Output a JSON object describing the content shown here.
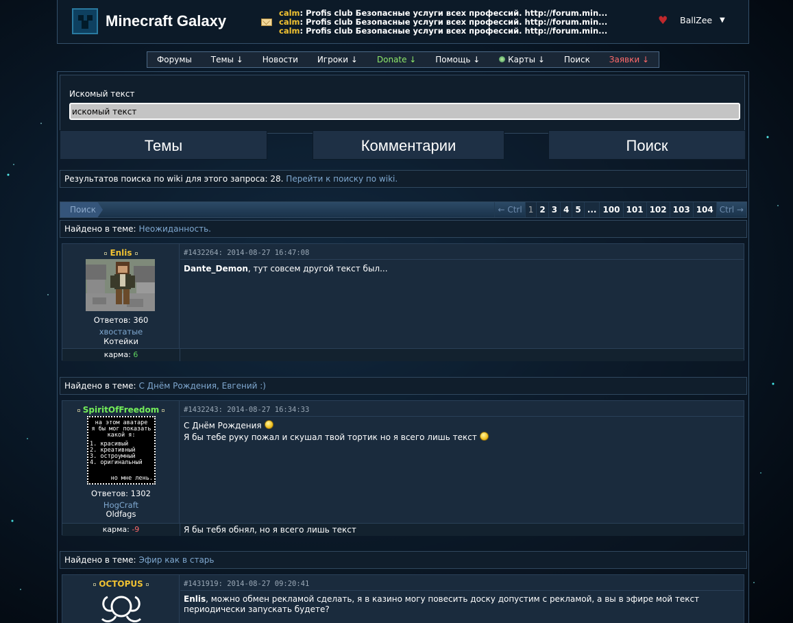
{
  "header": {
    "site_title": "Minecraft Galaxy",
    "user_name": "BallZee",
    "shouts": [
      {
        "who": "calm",
        "text": ": Profis club Безопасные услуги всех профессий. http://forum.min..."
      },
      {
        "who": "calm",
        "text": ": Profis club Безопасные услуги всех профессий. http://forum.min..."
      },
      {
        "who": "calm",
        "text": ": Profis club Безопасные услуги всех профессий. http://forum.min..."
      }
    ]
  },
  "nav": [
    "Форумы",
    "Темы ↓",
    "Новости",
    "Игроки ↓",
    "Donate ↓",
    "Помощь ↓",
    "Карты ↓",
    "Поиск",
    "Заявки ↓"
  ],
  "search": {
    "label": "Искомый текст",
    "value": "искомый текст",
    "tab_topics": "Темы",
    "tab_comments": "Комментарии",
    "tab_search": "Поиск"
  },
  "wiki": {
    "text": "Результатов поиска по wiki для этого запроса: 28.",
    "link": "Перейти к поиску по wiki."
  },
  "pager": {
    "label": "Поиск",
    "prev": "← Ctrl",
    "pages": [
      "1",
      "2",
      "3",
      "4",
      "5",
      "...",
      "100",
      "101",
      "102",
      "103",
      "104"
    ],
    "next": "Ctrl →"
  },
  "found_label": "Найдено в теме:",
  "results": [
    {
      "topic": "Неожиданность.",
      "author": "Enlis",
      "answers": "Ответов: 360",
      "clan": "хвостатые",
      "rank": "Котейки",
      "karma_label": "карма:",
      "karma": "6",
      "meta": "#1432264: 2014-08-27 16:47:08",
      "mention": "Dante_Demon",
      "line1": ", тут совсем другой текст был...",
      "line2": "",
      "signature": ""
    },
    {
      "topic": "С Днём Рождения, Евгений :)",
      "author": "SpiritOfFreedom",
      "answers": "Ответов: 1302",
      "clan": "HogCraft",
      "rank": "Oldfags",
      "karma_label": "карма:",
      "karma": "-9",
      "meta": "#1432243: 2014-08-27 16:34:33",
      "mention": "",
      "line1": "С Днём Рождения",
      "line2": "Я бы тебе руку пожал и скушал твой тортик но я всего лишь текст",
      "signature": "Я бы тебя обнял, но я всего лишь текст",
      "avatar_text": [
        "на этом аватаре",
        "я бы мог показать",
        "какой я:",
        "1. красивый",
        "2. креативный",
        "3. остроумный",
        "4. оригинальный",
        "но мне лень."
      ]
    },
    {
      "topic": "Эфир как в старь",
      "author": "OCTOPUS",
      "meta": "#1431919: 2014-08-27 09:20:41",
      "mention": "Enlis",
      "line1": ", можно обмен рекламой сделать, я в казино могу повесить доску допустим с рекламой, а вы в эфире мой текст",
      "line2": "периодически запускать будете?"
    }
  ],
  "colors": {
    "accent_link": "#7fa8d0",
    "author_gold": "#f1c232",
    "author_green": "#74ee5a",
    "karma_positive": "#5fd35f",
    "karma_negative": "#ff6a6a",
    "donate": "#8ee86a",
    "requests": "#ff6a6a"
  }
}
